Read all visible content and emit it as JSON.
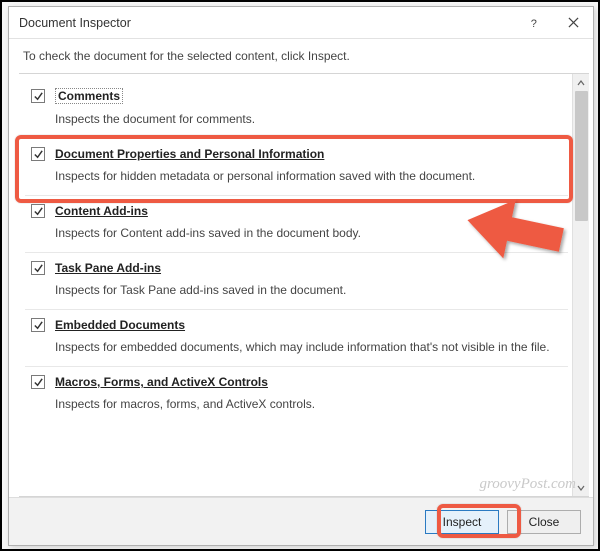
{
  "title": "Document Inspector",
  "instruction": "To check the document for the selected content, click Inspect.",
  "items": [
    {
      "label": "Comments",
      "desc": "Inspects the document for comments.",
      "checked": true,
      "focused": true
    },
    {
      "label": "Document Properties and Personal Information",
      "desc": "Inspects for hidden metadata or personal information saved with the document.",
      "checked": true
    },
    {
      "label": "Content Add-ins",
      "desc": "Inspects for Content add-ins saved in the document body.",
      "checked": true
    },
    {
      "label": "Task Pane Add-ins",
      "desc": "Inspects for Task Pane add-ins saved in the document.",
      "checked": true
    },
    {
      "label": "Embedded Documents",
      "desc": "Inspects for embedded documents, which may include information that's not visible in the file.",
      "checked": true
    },
    {
      "label": "Macros, Forms, and ActiveX Controls",
      "desc": "Inspects for macros, forms, and ActiveX controls.",
      "checked": true
    }
  ],
  "buttons": {
    "inspect": "Inspect",
    "close": "Close"
  },
  "watermark": "groovyPost.com"
}
